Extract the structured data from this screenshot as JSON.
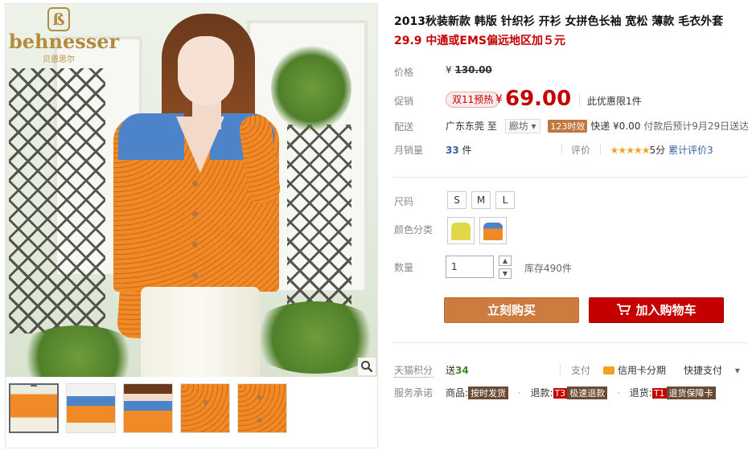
{
  "brand": {
    "name": "behnesser",
    "sub": "贝恩思尔"
  },
  "product": {
    "title": "2013秋装新款 韩版 针织衫 开衫 女拼色长袖 宽松 薄款 毛衣外套",
    "subtitle": "29.9 中通或EMS偏远地区加５元"
  },
  "pricing": {
    "orig_label": "价格",
    "orig_currency": "¥",
    "orig_value": "130.00",
    "promo_label": "促销",
    "promo_badge": "双11预热",
    "currency": "¥",
    "price": "69.00",
    "limit": "此优惠限1件"
  },
  "delivery": {
    "label": "配送",
    "from": "广东东莞",
    "to_word": "至",
    "to_value": "廊坊",
    "badge": "123时效",
    "service": "快递 ¥0.00",
    "eta": "付款后预计9月29日送达"
  },
  "sales": {
    "label": "月销量",
    "count": "33",
    "unit": "件",
    "rating_label": "评价",
    "stars": "★★★★★",
    "score": "5分",
    "reviews": "累计评价3"
  },
  "options": {
    "size_label": "尺码",
    "sizes": [
      "S",
      "M",
      "L"
    ],
    "color_label": "颜色分类",
    "color_swatches": [
      "#e9d44a",
      "#f08a26"
    ]
  },
  "quantity": {
    "label": "数量",
    "value": "1",
    "stock": "库存490件"
  },
  "actions": {
    "buy_now": "立刻购买",
    "add_to_cart": "加入购物车"
  },
  "extra": {
    "points_label": "天猫积分",
    "points_prefix": "送",
    "points_value": "34",
    "pay_label": "支付",
    "credit": "信用卡分期",
    "quickpay": "快捷支付",
    "promise_label": "服务承诺",
    "goods_prefix": "商品:",
    "goods_tag": "按时发货",
    "refund_prefix": "退款:",
    "refund_code": "T3",
    "refund_tag": "极速退款",
    "return_prefix": "退货:",
    "return_code": "T1",
    "return_tag": "退货保障卡"
  },
  "colors": {
    "accent": "#c40000",
    "buy": "#cd7c3f",
    "brand_gold": "#b48a3c"
  }
}
